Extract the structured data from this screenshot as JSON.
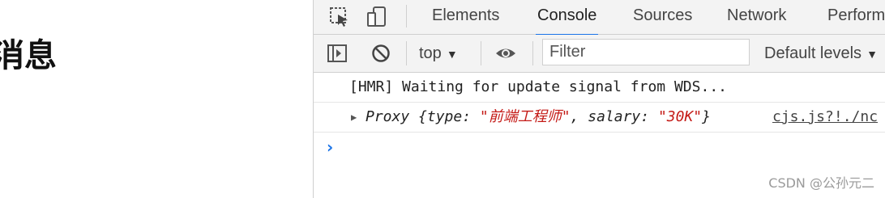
{
  "page": {
    "title": "消息"
  },
  "devtools": {
    "tabs": [
      {
        "label": "Elements"
      },
      {
        "label": "Console"
      },
      {
        "label": "Sources"
      },
      {
        "label": "Network"
      },
      {
        "label": "Perform"
      }
    ],
    "active_tab": "Console",
    "icons": {
      "inspect": "inspect-element-icon",
      "device": "device-toolbar-icon",
      "sidebar": "show-console-sidebar-icon",
      "clear": "clear-console-icon",
      "eye": "live-expression-icon"
    },
    "toolbar": {
      "context_label": "top",
      "filter_placeholder": "Filter",
      "levels_label": "Default levels"
    },
    "console": {
      "line1": "[HMR] Waiting for update signal from WDS...",
      "line2": {
        "prefix": "Proxy {type: ",
        "type_value": "\"前端工程师\"",
        "middle": ", salary: ",
        "salary_value": "\"30K\"",
        "suffix": "}",
        "source": "cjs.js?!./nc"
      },
      "prompt": "›"
    },
    "colors": {
      "accent": "#1a73e8",
      "string": "#c41a16",
      "toolbar_bg": "#f3f3f3"
    }
  },
  "watermark": "CSDN @公孙元二"
}
